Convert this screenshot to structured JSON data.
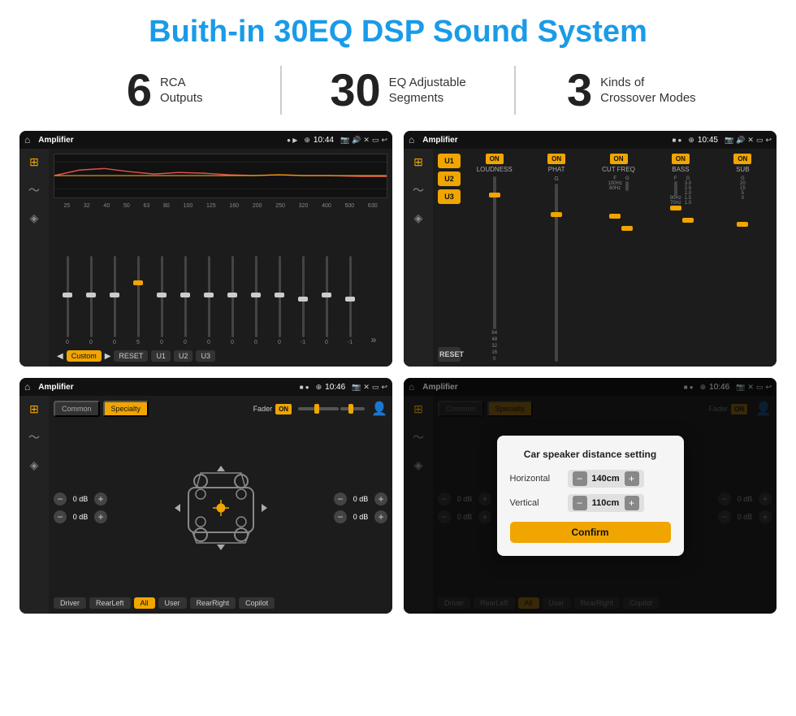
{
  "header": {
    "title": "Buith-in 30EQ DSP Sound System"
  },
  "stats": [
    {
      "number": "6",
      "label_line1": "RCA",
      "label_line2": "Outputs"
    },
    {
      "number": "30",
      "label_line1": "EQ Adjustable",
      "label_line2": "Segments"
    },
    {
      "number": "3",
      "label_line1": "Kinds of",
      "label_line2": "Crossover Modes"
    }
  ],
  "screens": [
    {
      "id": "screen1",
      "app_name": "Amplifier",
      "time": "10:44",
      "type": "eq"
    },
    {
      "id": "screen2",
      "app_name": "Amplifier",
      "time": "10:45",
      "type": "crossover"
    },
    {
      "id": "screen3",
      "app_name": "Amplifier",
      "time": "10:46",
      "type": "fader"
    },
    {
      "id": "screen4",
      "app_name": "Amplifier",
      "time": "10:46",
      "type": "dialog"
    }
  ],
  "eq": {
    "freq_labels": [
      "25",
      "32",
      "40",
      "50",
      "63",
      "80",
      "100",
      "125",
      "160",
      "200",
      "250",
      "320",
      "400",
      "500",
      "630"
    ],
    "slider_values": [
      "0",
      "0",
      "0",
      "5",
      "0",
      "0",
      "0",
      "0",
      "0",
      "0",
      "-1",
      "0",
      "-1"
    ],
    "bottom_buttons": [
      "Custom",
      "RESET",
      "U1",
      "U2",
      "U3"
    ]
  },
  "crossover": {
    "presets": [
      "U1",
      "U2",
      "U3"
    ],
    "controls": [
      "LOUDNESS",
      "PHAT",
      "CUT FREQ",
      "BASS",
      "SUB"
    ]
  },
  "fader": {
    "tabs": [
      "Common",
      "Specialty"
    ],
    "fader_label": "Fader",
    "db_values": [
      "0 dB",
      "0 dB",
      "0 dB",
      "0 dB"
    ],
    "bottom_buttons": [
      "Driver",
      "RearLeft",
      "All",
      "User",
      "RearRight",
      "Copilot"
    ]
  },
  "dialog": {
    "title": "Car speaker distance setting",
    "horizontal_label": "Horizontal",
    "horizontal_value": "140cm",
    "vertical_label": "Vertical",
    "vertical_value": "110cm",
    "confirm_label": "Confirm"
  }
}
